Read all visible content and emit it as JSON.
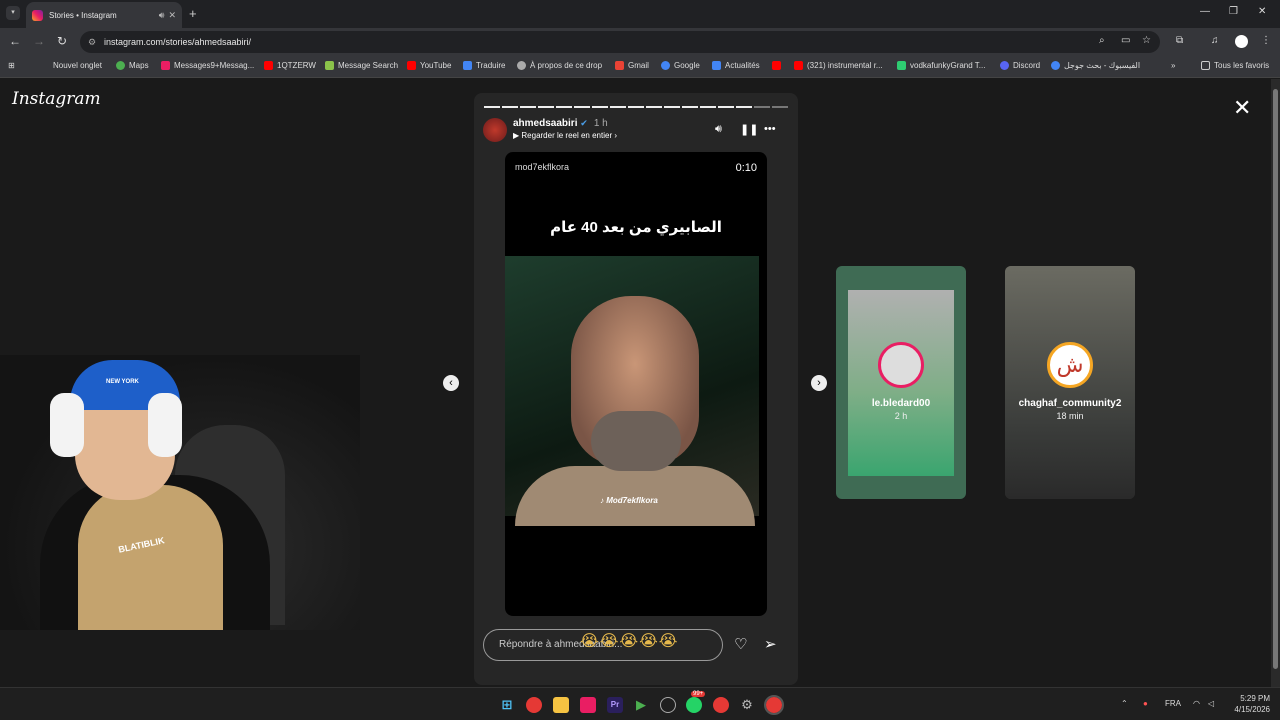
{
  "browser": {
    "tab_title": "Stories • Instagram",
    "url": "instagram.com/stories/ahmedsaabiri/",
    "bookmarks": [
      {
        "label": "Nouvel onglet",
        "color": "#888888"
      },
      {
        "label": "Maps",
        "color": "#4caf50"
      },
      {
        "label": "Messages9+Messag...",
        "color": "#e91e63"
      },
      {
        "label": "1QTZERW",
        "color": "#ff0000"
      },
      {
        "label": "Message Search",
        "color": "#8bc34a"
      },
      {
        "label": "YouTube",
        "color": "#ff0000"
      },
      {
        "label": "Traduire",
        "color": "#4285f4"
      },
      {
        "label": "À propos de ce drop",
        "color": "#aaaaaa"
      },
      {
        "label": "Gmail",
        "color": "#ea4335"
      },
      {
        "label": "Google",
        "color": "#4285f4"
      },
      {
        "label": "Actualités",
        "color": "#4285f4"
      },
      {
        "label": "",
        "color": "#ff0000"
      },
      {
        "label": "(321) instrumental r...",
        "color": "#ff0000"
      },
      {
        "label": "vodkafunkyGrand T...",
        "color": "#2ecc71"
      },
      {
        "label": "Discord",
        "color": "#5865f2"
      },
      {
        "label": "الفيسبوك - بحث جوجل",
        "color": "#4285f4"
      }
    ],
    "all_bookmarks": "Tous les favoris"
  },
  "instagram": {
    "logo": "Instagram",
    "story": {
      "username": "ahmedsaabiri",
      "time": "1 h",
      "reel_link": "Regarder le reel en entier",
      "media_account": "mod7ekflkora",
      "timer": "0:10",
      "caption": "الصابيري من بعد 40 عام",
      "watermark": "Mod7ekflkora",
      "reply_placeholder": "Répondre à ahmedsaabiri...",
      "emojis": "😭😭😭😭😭",
      "progress_segments": 17,
      "progress_done": 15
    },
    "next_stories": [
      {
        "username": "le.bledard00",
        "time": "2 h"
      },
      {
        "username": "chaghaf_community2",
        "time": "18 min",
        "avatar_glyph": "ش"
      }
    ]
  },
  "webcam": {
    "cap_text": "NEW YORK",
    "shirt_text": "BLATIBLIK"
  },
  "taskbar": {
    "badge": "99+",
    "language": "FRA",
    "time": "5:29 PM",
    "date": "4/15/2026"
  }
}
